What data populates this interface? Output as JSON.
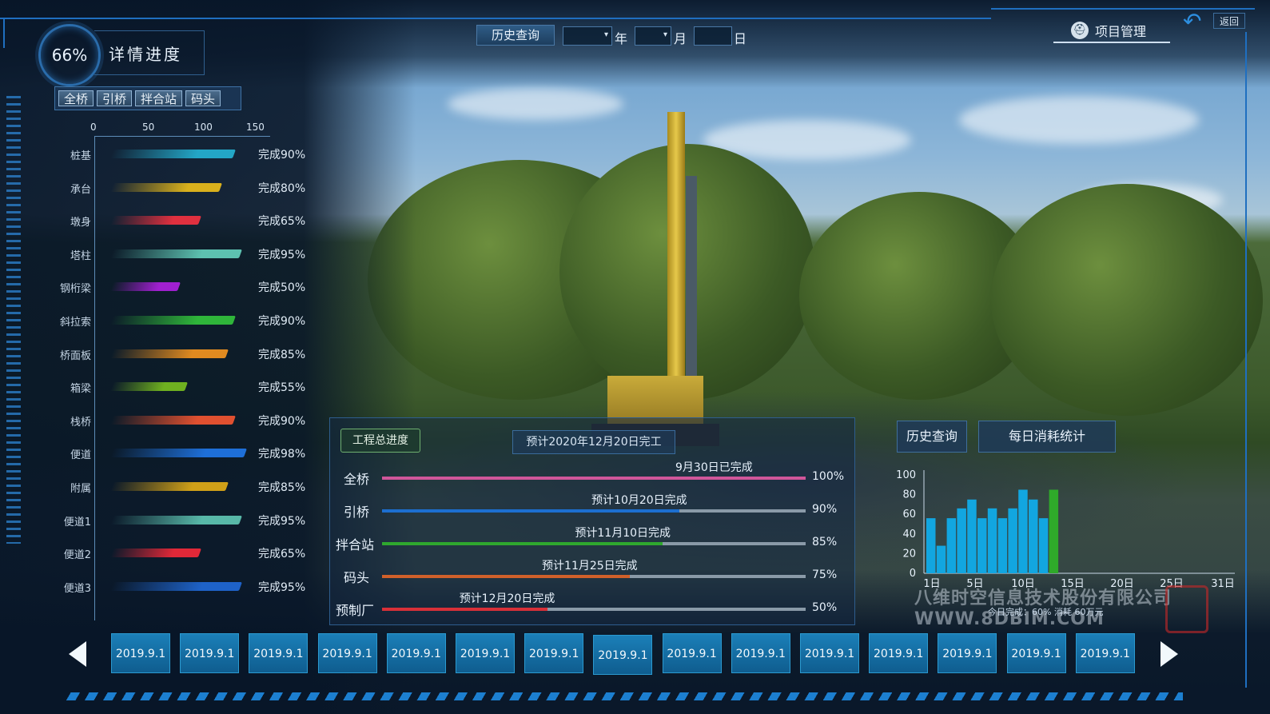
{
  "header": {
    "gauge_value": "66%",
    "title": "详情进度",
    "tabs": [
      "全桥",
      "引桥",
      "拌合站",
      "码头"
    ],
    "history_query": "历史查询",
    "year_label": "年",
    "month_label": "月",
    "day_label": "日",
    "project_mgmt": "项目管理",
    "back_label": "返回"
  },
  "left_chart": {
    "axis_ticks": [
      "0",
      "50",
      "100",
      "150"
    ],
    "rows": [
      {
        "label": "桩基",
        "value": 90,
        "text": "完成90%",
        "color": "#23a6c6"
      },
      {
        "label": "承台",
        "value": 80,
        "text": "完成80%",
        "color": "#d9b01c"
      },
      {
        "label": "墩身",
        "value": 65,
        "text": "完成65%",
        "color": "#e0303f"
      },
      {
        "label": "塔柱",
        "value": 95,
        "text": "完成95%",
        "color": "#5dc1b0"
      },
      {
        "label": "钢桁梁",
        "value": 50,
        "text": "完成50%",
        "color": "#a020d0"
      },
      {
        "label": "斜拉索",
        "value": 90,
        "text": "完成90%",
        "color": "#2fb53a"
      },
      {
        "label": "桥面板",
        "value": 85,
        "text": "完成85%",
        "color": "#e08a20"
      },
      {
        "label": "箱梁",
        "value": 55,
        "text": "完成55%",
        "color": "#6fb020"
      },
      {
        "label": "栈桥",
        "value": 90,
        "text": "完成90%",
        "color": "#e05030"
      },
      {
        "label": "便道",
        "value": 98,
        "text": "完成98%",
        "color": "#1e6fd8"
      },
      {
        "label": "附属",
        "value": 85,
        "text": "完成85%",
        "color": "#d0a018"
      },
      {
        "label": "便道1",
        "value": 95,
        "text": "完成95%",
        "color": "#58b8a8"
      },
      {
        "label": "便道2",
        "value": 65,
        "text": "完成65%",
        "color": "#e02838"
      },
      {
        "label": "便道3",
        "value": 95,
        "text": "完成95%",
        "color": "#1e62c8"
      }
    ]
  },
  "progress_panel": {
    "title": "工程总进度",
    "estimate": "预计2020年12月20日完工",
    "rows": [
      {
        "label": "全桥",
        "note": "9月30日已完成",
        "pct": "100%",
        "value": 100,
        "color": "#d0569a"
      },
      {
        "label": "引桥",
        "note": "预计10月20日完成",
        "pct": "90%",
        "value": 90,
        "color": "#1c6fd0"
      },
      {
        "label": "拌合站",
        "note": "预计11月10日完成",
        "pct": "85%",
        "value": 85,
        "color": "#2fa82e"
      },
      {
        "label": "码头",
        "note": "预计11月25日完成",
        "pct": "75%",
        "value": 75,
        "color": "#d0602a"
      },
      {
        "label": "预制厂",
        "note": "预计12月20日完成",
        "pct": "50%",
        "value": 50,
        "color": "#d83038"
      }
    ]
  },
  "right_panel": {
    "history_btn": "历史查询",
    "daily_btn": "每日消耗统计",
    "footer_text": "今日完成：60%  消耗 60万元",
    "watermark": "八维时空信息技术股份有限公司 WWW.8DBIM.COM"
  },
  "chart_data": {
    "type": "bar",
    "categories": [
      "1",
      "2",
      "3",
      "4",
      "5",
      "6",
      "7",
      "8",
      "9",
      "10",
      "11",
      "12",
      "13",
      "14"
    ],
    "values": [
      56,
      28,
      56,
      66,
      75,
      56,
      66,
      56,
      66,
      85,
      75,
      56,
      85
    ],
    "highlight_index": 12,
    "highlight_color": "#2faa2a",
    "bar_color": "#12a6e0",
    "y_ticks": [
      "100",
      "80",
      "60",
      "40",
      "20",
      "0"
    ],
    "x_ticks": [
      "1日",
      "5日",
      "10日",
      "15日",
      "20日",
      "25日",
      "31日"
    ],
    "ylim": [
      0,
      100
    ],
    "grid": false
  },
  "date_strip": {
    "dates": [
      "2019.9.1",
      "2019.9.1",
      "2019.9.1",
      "2019.9.1",
      "2019.9.1",
      "2019.9.1",
      "2019.9.1",
      "2019.9.1",
      "2019.9.1",
      "2019.9.1",
      "2019.9.1",
      "2019.9.1",
      "2019.9.1",
      "2019.9.1",
      "2019.9.1"
    ]
  }
}
